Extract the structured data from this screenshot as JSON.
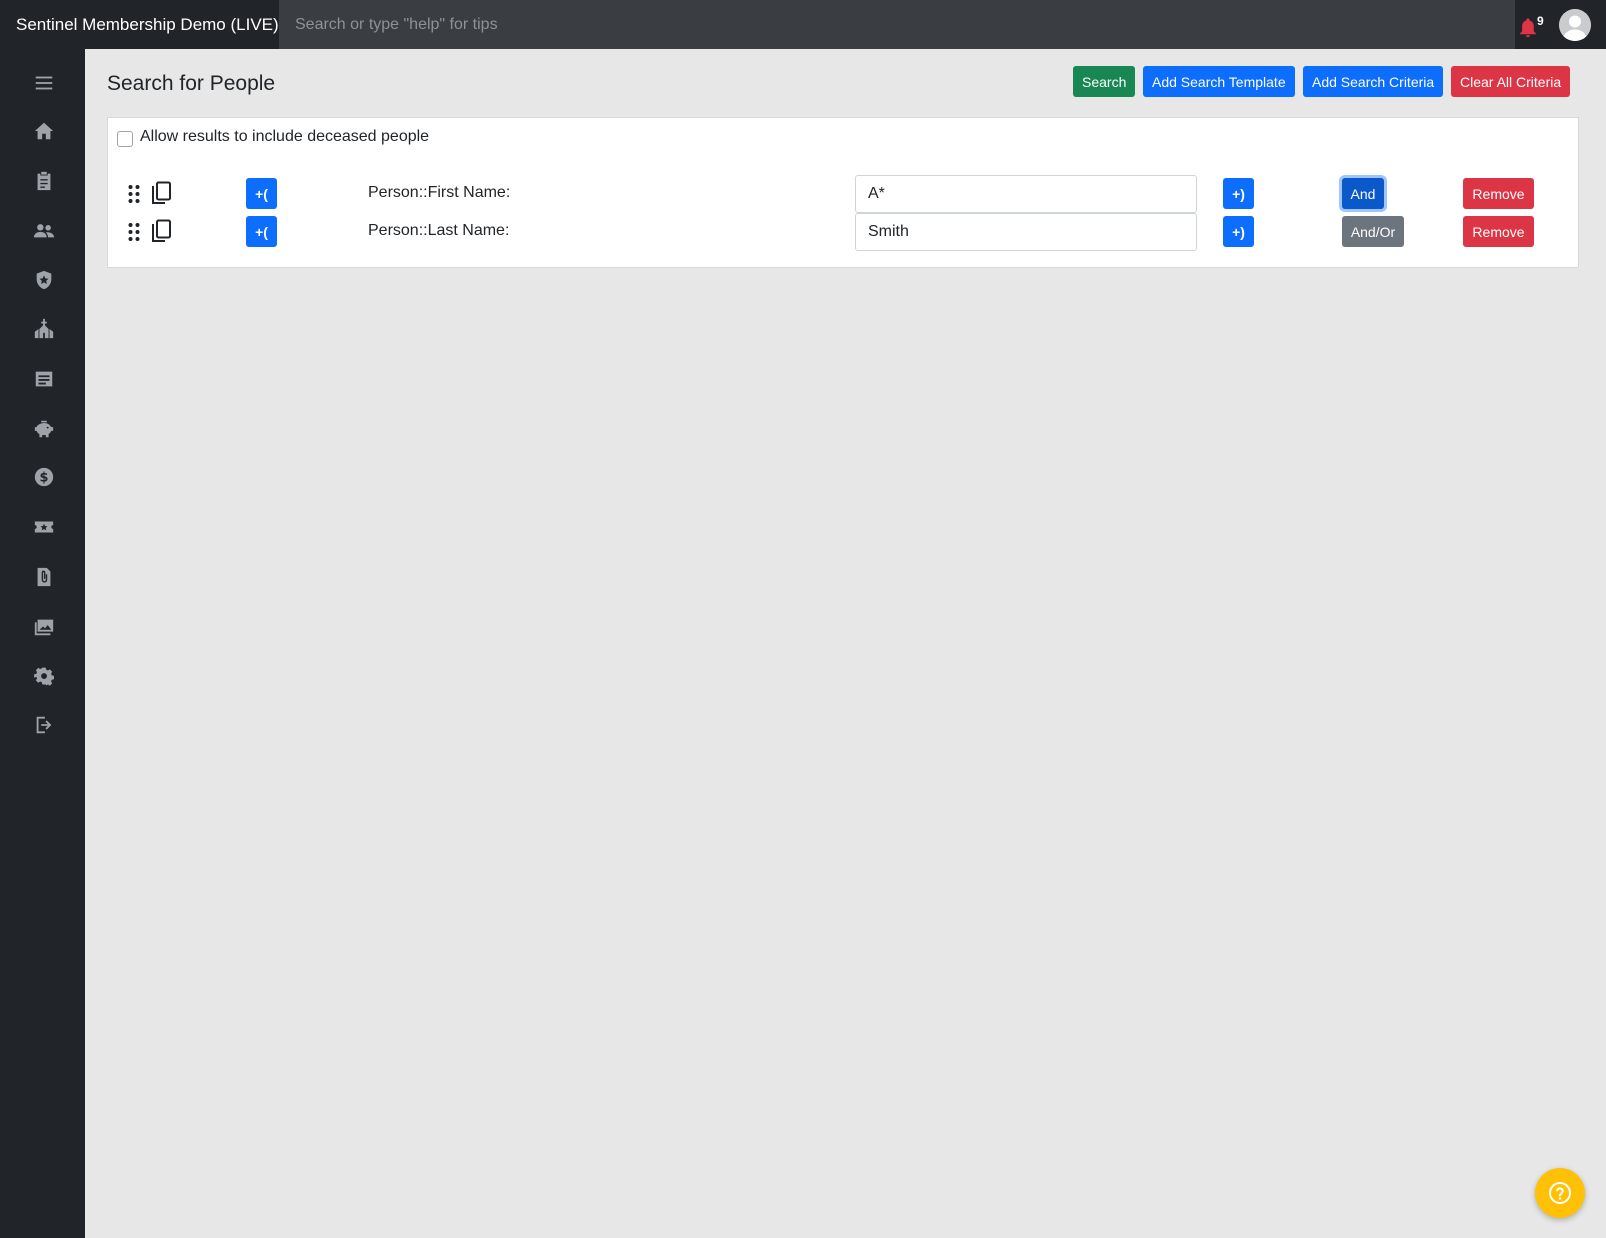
{
  "app": {
    "title": "Sentinel Membership Demo (LIVE)"
  },
  "topbar": {
    "search_placeholder": "Search or type \"help\" for tips",
    "notification_count": "9",
    "notification_color": "#dc3545"
  },
  "sidebar": {
    "items": [
      {
        "icon": "menu-icon"
      },
      {
        "icon": "home-icon"
      },
      {
        "icon": "clipboard-icon"
      },
      {
        "icon": "people-icon"
      },
      {
        "icon": "shield-icon"
      },
      {
        "icon": "church-icon"
      },
      {
        "icon": "document-icon"
      },
      {
        "icon": "piggy-bank-icon"
      },
      {
        "icon": "dollar-icon"
      },
      {
        "icon": "ticket-icon"
      },
      {
        "icon": "attachment-icon"
      },
      {
        "icon": "images-icon"
      },
      {
        "icon": "gear-icon"
      },
      {
        "icon": "logout-icon"
      }
    ]
  },
  "page": {
    "title": "Search for People"
  },
  "toolbar": {
    "search_label": "Search",
    "add_template_label": "Add Search Template",
    "add_criteria_label": "Add Search Criteria",
    "clear_label": "Clear All Criteria"
  },
  "options": {
    "deceased_label": "Allow results to include deceased people",
    "deceased_checked": false
  },
  "criteria": [
    {
      "open_paren_label": "+(",
      "field_label": "Person::First Name:",
      "value": "A*",
      "close_paren_label": "+)",
      "logic_label": "And",
      "remove_label": "Remove"
    },
    {
      "open_paren_label": "+(",
      "field_label": "Person::Last Name:",
      "value": "Smith",
      "close_paren_label": "+)",
      "logic_label": "And/Or",
      "remove_label": "Remove"
    }
  ],
  "help": {
    "icon": "help-icon",
    "color": "#ffc107"
  }
}
